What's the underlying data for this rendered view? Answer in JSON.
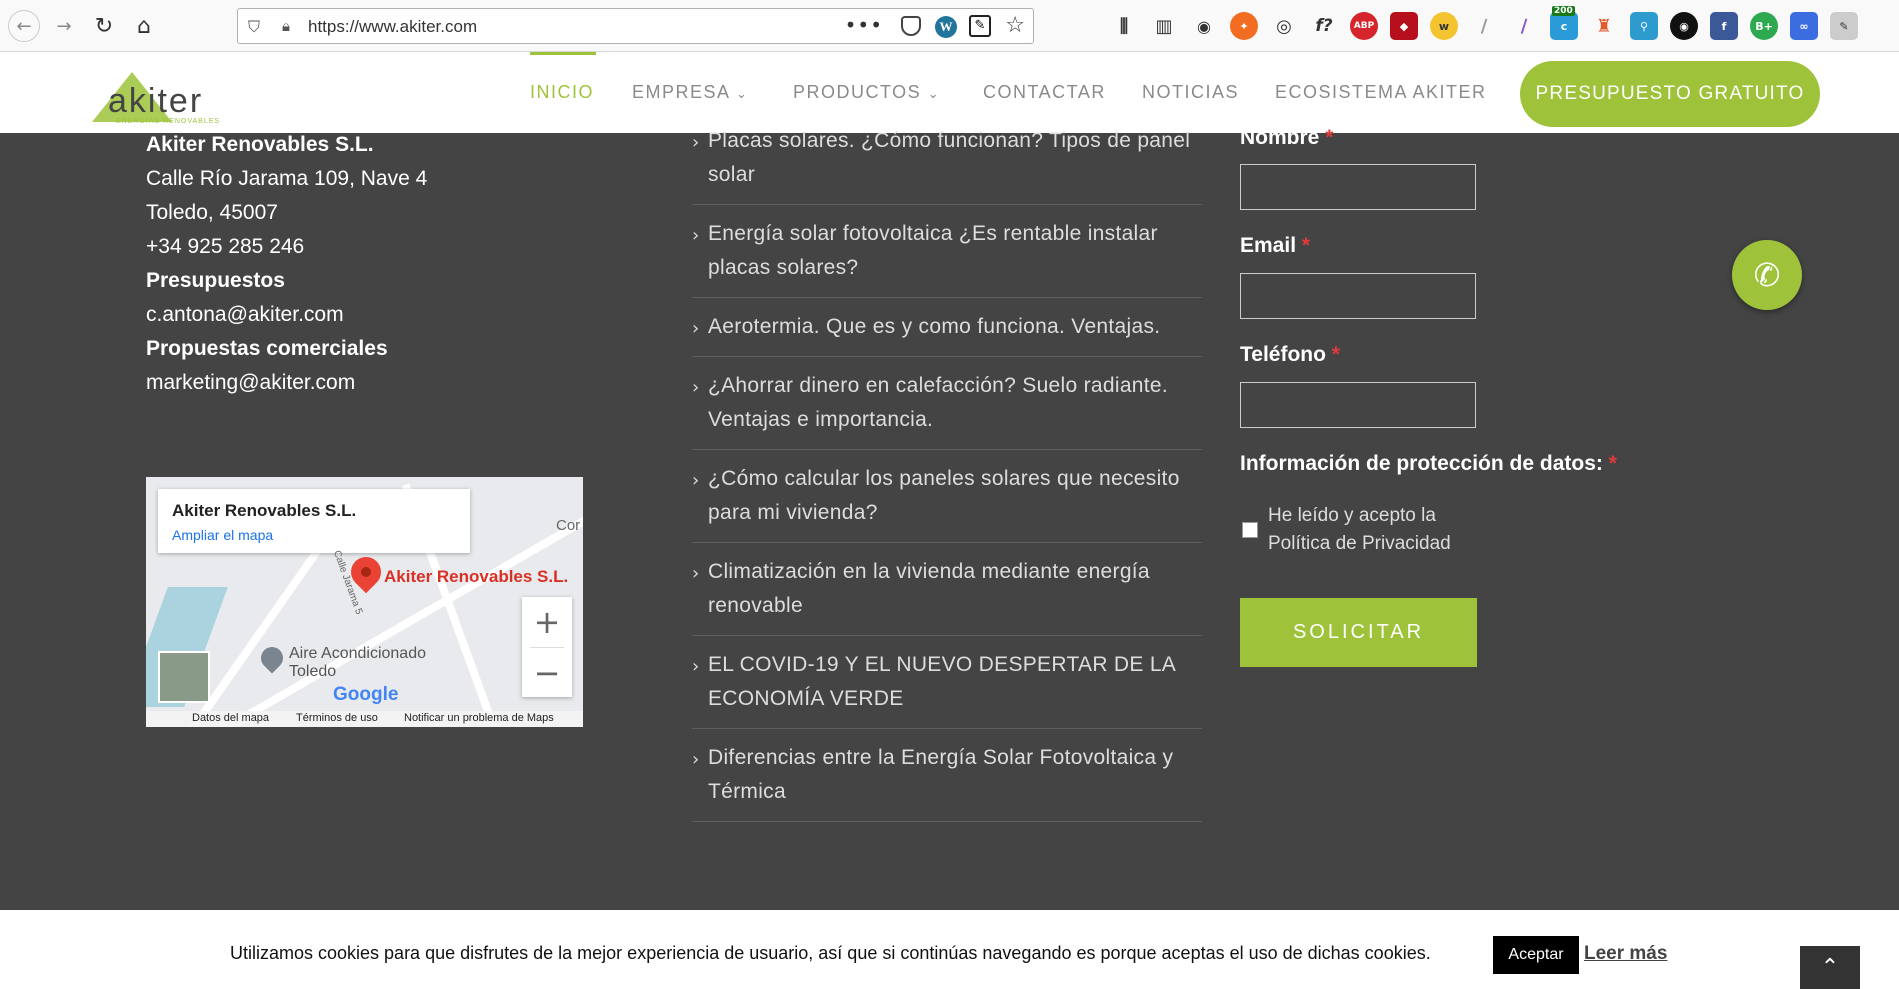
{
  "browser": {
    "url": "https://www.akiter.com",
    "ext_badge": "200",
    "ext_labels": {
      "abp": "ABP",
      "func": "f?",
      "bplus": "B+"
    }
  },
  "header": {
    "logo_text": "akiter",
    "logo_tagline": "ENERGÍAS RENOVABLES",
    "menu": [
      "INICIO",
      "EMPRESA",
      "PRODUCTOS",
      "CONTACTAR",
      "NOTICIAS",
      "ECOSISTEMA AKITER"
    ],
    "cta_label": "PRESUPUESTO GRATUITO"
  },
  "contact": {
    "company": "Akiter Renovables S.L.",
    "address1": "Calle Río Jarama 109, Nave 4",
    "address2": "Toledo, 45007",
    "phone": "+34 925 285 246",
    "quotes_label": "Presupuestos",
    "quotes_email": "c.antona@akiter.com",
    "commercial_label": "Propuestas comerciales",
    "commercial_email": "marketing@akiter.com"
  },
  "map": {
    "card_title": "Akiter Renovables S.L.",
    "card_link": "Ampliar el mapa",
    "pin_label": "Akiter Renovables S.L.",
    "poi_line1": "Aire Acondicionado",
    "poi_line2": "Toledo",
    "street": "Calle Jarama 5",
    "corner_text": "Cor",
    "google": "Google",
    "attr_data": "Datos del mapa",
    "attr_terms": "Términos de uso",
    "attr_report": "Notificar un problema de Maps"
  },
  "posts": [
    "Placas solares. ¿Cómo funcionan? Tipos de panel solar",
    "Energía solar fotovoltaica ¿Es rentable instalar placas solares?",
    "Aerotermia. Que es y como funciona. Ventajas.",
    "¿Ahorrar dinero en calefacción? Suelo radiante. Ventajas e importancia.",
    "¿Cómo calcular los paneles solares que necesito para mi vivienda?",
    "Climatización en la vivienda mediante energía renovable",
    "EL COVID-19 Y EL NUEVO DESPERTAR DE LA ECONOMÍA VERDE",
    "Diferencias entre la Energía Solar Fotovoltaica y Térmica"
  ],
  "form": {
    "name_label": "Nombre",
    "email_label": "Email",
    "phone_label": "Teléfono",
    "privacy_label": "Información de protección de datos:",
    "required_mark": "*",
    "check_line1": "He leído y acepto la",
    "check_line2": "Política de Privacidad",
    "submit_label": "SOLICITAR"
  },
  "cookie": {
    "message": "Utilizamos cookies para que disfrutes de la mejor experiencia de usuario, así que si continúas navegando es porque aceptas el uso de dichas cookies.",
    "accept": "Aceptar",
    "more": "Leer más"
  },
  "colors": {
    "accent": "#9ec33b",
    "footer_bg": "#444444",
    "required": "#e03a3a"
  }
}
